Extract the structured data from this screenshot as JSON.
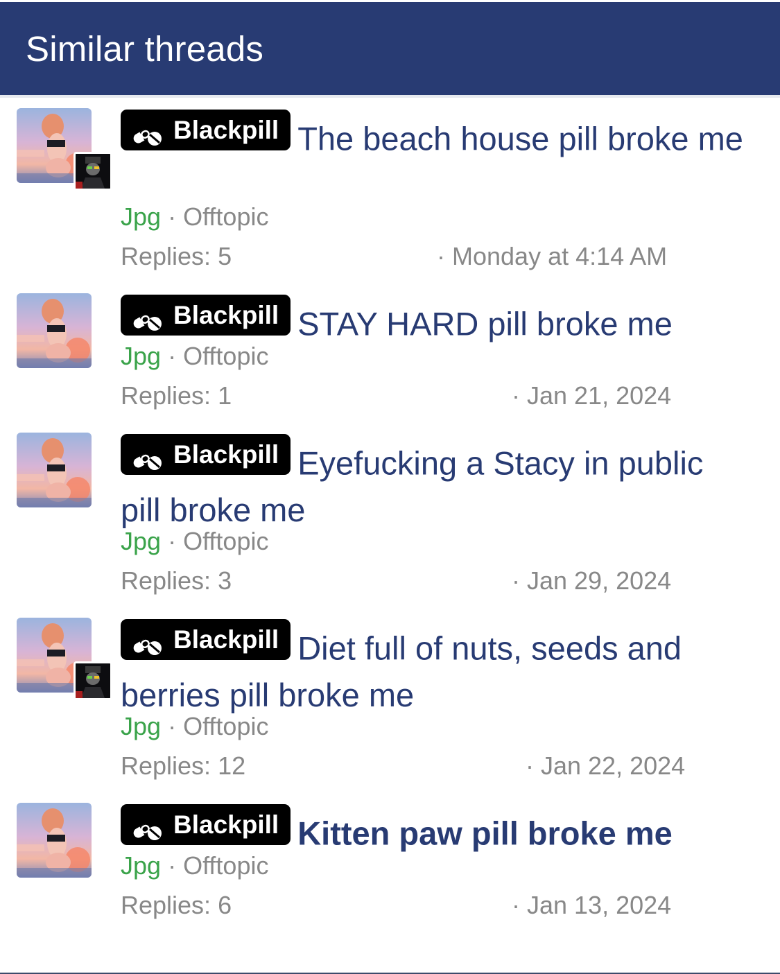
{
  "header": {
    "title": "Similar threads"
  },
  "threads": [
    {
      "prefix": "Blackpill",
      "title": "The beach house pill broke me",
      "author": "Jpg",
      "separator": "·",
      "forum": "Offtopic",
      "replies": "Replies: 5",
      "date": "· Monday at 4:14 AM",
      "has_secondary_avatar": true
    },
    {
      "prefix": "Blackpill",
      "title": "STAY HARD pill broke me",
      "author": "Jpg",
      "separator": "·",
      "forum": "Offtopic",
      "replies": "Replies: 1",
      "date": "· Jan 21, 2024",
      "has_secondary_avatar": false
    },
    {
      "prefix": "Blackpill",
      "title": "Eyefucking a Stacy in public pill broke me",
      "author": "Jpg",
      "separator": "·",
      "forum": "Offtopic",
      "replies": "Replies: 3",
      "date": "· Jan 29, 2024",
      "has_secondary_avatar": false
    },
    {
      "prefix": "Blackpill",
      "title": "Diet full of nuts, seeds and berries pill broke me",
      "author": "Jpg",
      "separator": "·",
      "forum": "Offtopic",
      "replies": "Replies: 12",
      "date": "· Jan 22, 2024",
      "has_secondary_avatar": true
    },
    {
      "prefix": "Blackpill",
      "title": "Kitten paw pill broke me",
      "author": "Jpg",
      "separator": "·",
      "forum": "Offtopic",
      "replies": "Replies: 6",
      "date": "· Jan 13, 2024",
      "has_secondary_avatar": false
    }
  ],
  "icons": {
    "prefix_icon": "pills-icon",
    "avatar": "user-avatar",
    "secondary_avatar": "last-poster-avatar"
  },
  "colors": {
    "header_bg": "#283b73",
    "title": "#283b73",
    "author": "#3aa34a",
    "meta": "#888888",
    "prefix_bg": "#000000"
  }
}
